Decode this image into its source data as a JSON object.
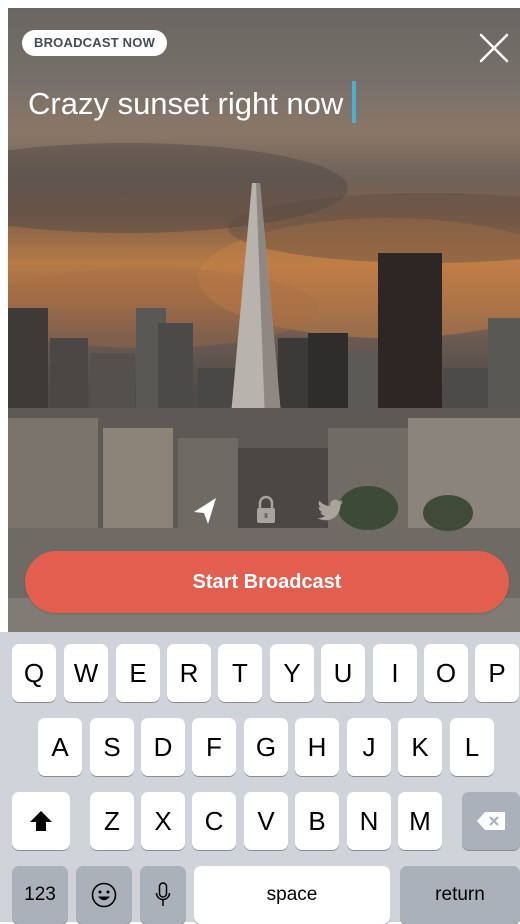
{
  "broadcast": {
    "badge_label": "BROADCAST NOW",
    "title_value": "Crazy sunset right now",
    "start_label": "Start Broadcast",
    "accent_color": "#e25f50",
    "caret_color": "#4bb0d6"
  },
  "share_icons": [
    "location-arrow-icon",
    "lock-icon",
    "twitter-icon"
  ],
  "keyboard": {
    "row1": [
      "Q",
      "W",
      "E",
      "R",
      "T",
      "Y",
      "U",
      "I",
      "O",
      "P"
    ],
    "row2": [
      "A",
      "S",
      "D",
      "F",
      "G",
      "H",
      "J",
      "K",
      "L"
    ],
    "row3": [
      "Z",
      "X",
      "C",
      "V",
      "B",
      "N",
      "M"
    ],
    "shift_icon": "shift-arrow-icon",
    "delete_icon": "backspace-icon",
    "numbers_label": "123",
    "emoji_icon": "emoji-icon",
    "mic_icon": "microphone-icon",
    "space_label": "space",
    "return_label": "return"
  }
}
